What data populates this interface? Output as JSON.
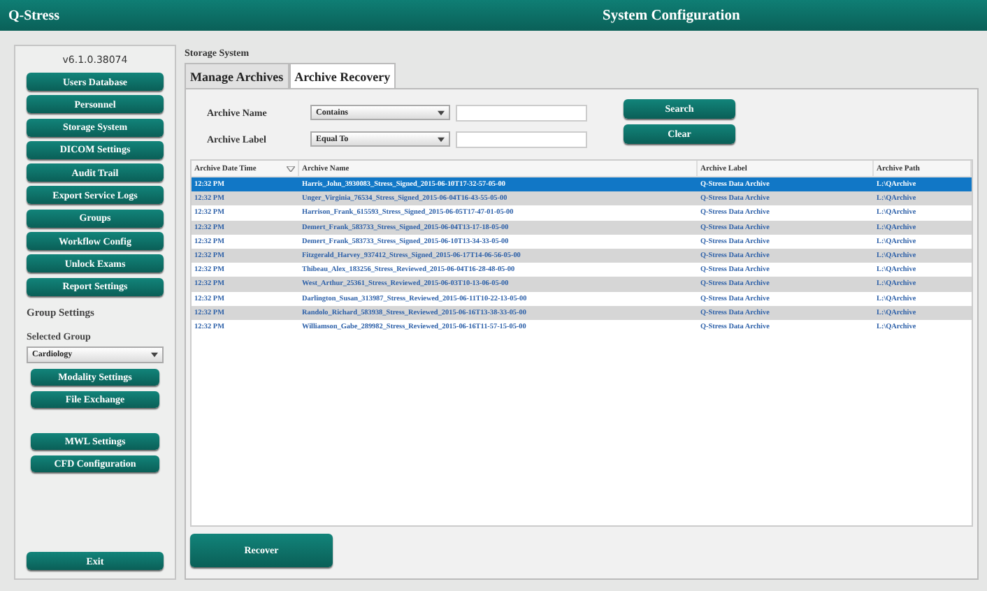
{
  "window": {
    "app_name": "Q-Stress",
    "title": "System Configuration"
  },
  "sidebar": {
    "version": "v6.1.0.38074",
    "buttons": [
      "Users Database",
      "Personnel",
      "Storage System",
      "DICOM Settings",
      "Audit Trail",
      "Export Service Logs",
      "Groups",
      "Workflow Config",
      "Unlock Exams",
      "Report Settings"
    ],
    "group_settings_label": "Group Settings",
    "selected_group_label": "Selected Group",
    "selected_group": "Cardiology",
    "group_buttons": [
      "Modality Settings",
      "File Exchange"
    ],
    "extra_buttons": [
      "MWL Settings",
      "CFD Configuration"
    ],
    "exit_button": "Exit"
  },
  "section_title": "Storage System",
  "tabs": [
    {
      "label": "Manage Archives",
      "selected": false
    },
    {
      "label": "Archive Recovery",
      "selected": true
    }
  ],
  "filters": [
    {
      "label": "Archive Name",
      "operator": "Contains"
    },
    {
      "label": "Archive Label",
      "operator": "Equal To"
    }
  ],
  "search_button": "Search",
  "clear_button": "Clear",
  "table": {
    "columns": [
      "Archive Date Time",
      "Archive Name",
      "Archive Label",
      "Archive Path"
    ],
    "rows": [
      {
        "cells": [
          "12:32 PM",
          "Harris_John_3930083_Stress_Signed_2015-06-10T17-32-57-05-00",
          "Q-Stress Data Archive",
          "L:\\QArchive"
        ],
        "selected": true
      },
      {
        "cells": [
          "12:32 PM",
          "Unger_Virginia_76534_Stress_Signed_2015-06-04T16-43-55-05-00",
          "Q-Stress Data Archive",
          "L:\\QArchive"
        ],
        "selected": false
      },
      {
        "cells": [
          "12:32 PM",
          "Harrison_Frank_615593_Stress_Signed_2015-06-05T17-47-01-05-00",
          "Q-Stress Data Archive",
          "L:\\QArchive"
        ],
        "selected": false
      },
      {
        "cells": [
          "12:32 PM",
          "Demert_Frank_583733_Stress_Signed_2015-06-04T13-17-18-05-00",
          "Q-Stress Data Archive",
          "L:\\QArchive"
        ],
        "selected": false
      },
      {
        "cells": [
          "12:32 PM",
          "Demert_Frank_583733_Stress_Signed_2015-06-10T13-34-33-05-00",
          "Q-Stress Data Archive",
          "L:\\QArchive"
        ],
        "selected": false
      },
      {
        "cells": [
          "12:32 PM",
          "Fitzgerald_Harvey_937412_Stress_Signed_2015-06-17T14-06-56-05-00",
          "Q-Stress Data Archive",
          "L:\\QArchive"
        ],
        "selected": false
      },
      {
        "cells": [
          "12:32 PM",
          "Thibeau_Alex_183256_Stress_Reviewed_2015-06-04T16-28-48-05-00",
          "Q-Stress Data Archive",
          "L:\\QArchive"
        ],
        "selected": false
      },
      {
        "cells": [
          "12:32 PM",
          "West_Arthur_25361_Stress_Reviewed_2015-06-03T10-13-06-05-00",
          "Q-Stress Data Archive",
          "L:\\QArchive"
        ],
        "selected": false
      },
      {
        "cells": [
          "12:32 PM",
          "Darlington_Susan_313987_Stress_Reviewed_2015-06-11T10-22-13-05-00",
          "Q-Stress Data Archive",
          "L:\\QArchive"
        ],
        "selected": false
      },
      {
        "cells": [
          "12:32 PM",
          "Randolo_Richard_583938_Stress_Reviewed_2015-06-16T13-38-33-05-00",
          "Q-Stress Data Archive",
          "L:\\QArchive"
        ],
        "selected": false
      },
      {
        "cells": [
          "12:32 PM",
          "Williamson_Gabe_289982_Stress_Reviewed_2015-06-16T11-57-15-05-00",
          "Q-Stress Data Archive",
          "L:\\QArchive"
        ],
        "selected": false
      }
    ]
  },
  "recover_button": "Recover"
}
